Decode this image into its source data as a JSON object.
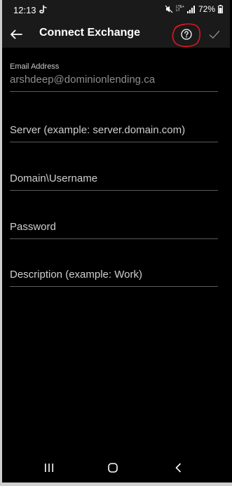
{
  "status_bar": {
    "time": "12:13",
    "lte_top": "LTE+",
    "lte_bottom": "LT",
    "battery_percent": "72%"
  },
  "app_bar": {
    "title": "Connect Exchange",
    "back_icon": "arrow-left-icon",
    "help_icon": "question-circle-icon",
    "confirm_icon": "checkmark-icon",
    "annotation_color": "#e0151f"
  },
  "form": {
    "email": {
      "label": "Email Address",
      "value": "arshdeep@dominionlending.ca"
    },
    "server": {
      "placeholder": "Server (example: server.domain.com)"
    },
    "domain_username": {
      "placeholder": "Domain\\Username"
    },
    "password": {
      "placeholder": "Password"
    },
    "description": {
      "placeholder": "Description (example: Work)"
    }
  },
  "nav_bar": {
    "recents_icon": "recent-apps-icon",
    "home_icon": "home-icon",
    "back_icon": "back-chevron-icon"
  },
  "colors": {
    "background": "#000000",
    "bar": "#1a1a1a",
    "text": "#ffffff",
    "prefilled_text": "#8e8e8e",
    "underline": "#5a5a5a"
  }
}
